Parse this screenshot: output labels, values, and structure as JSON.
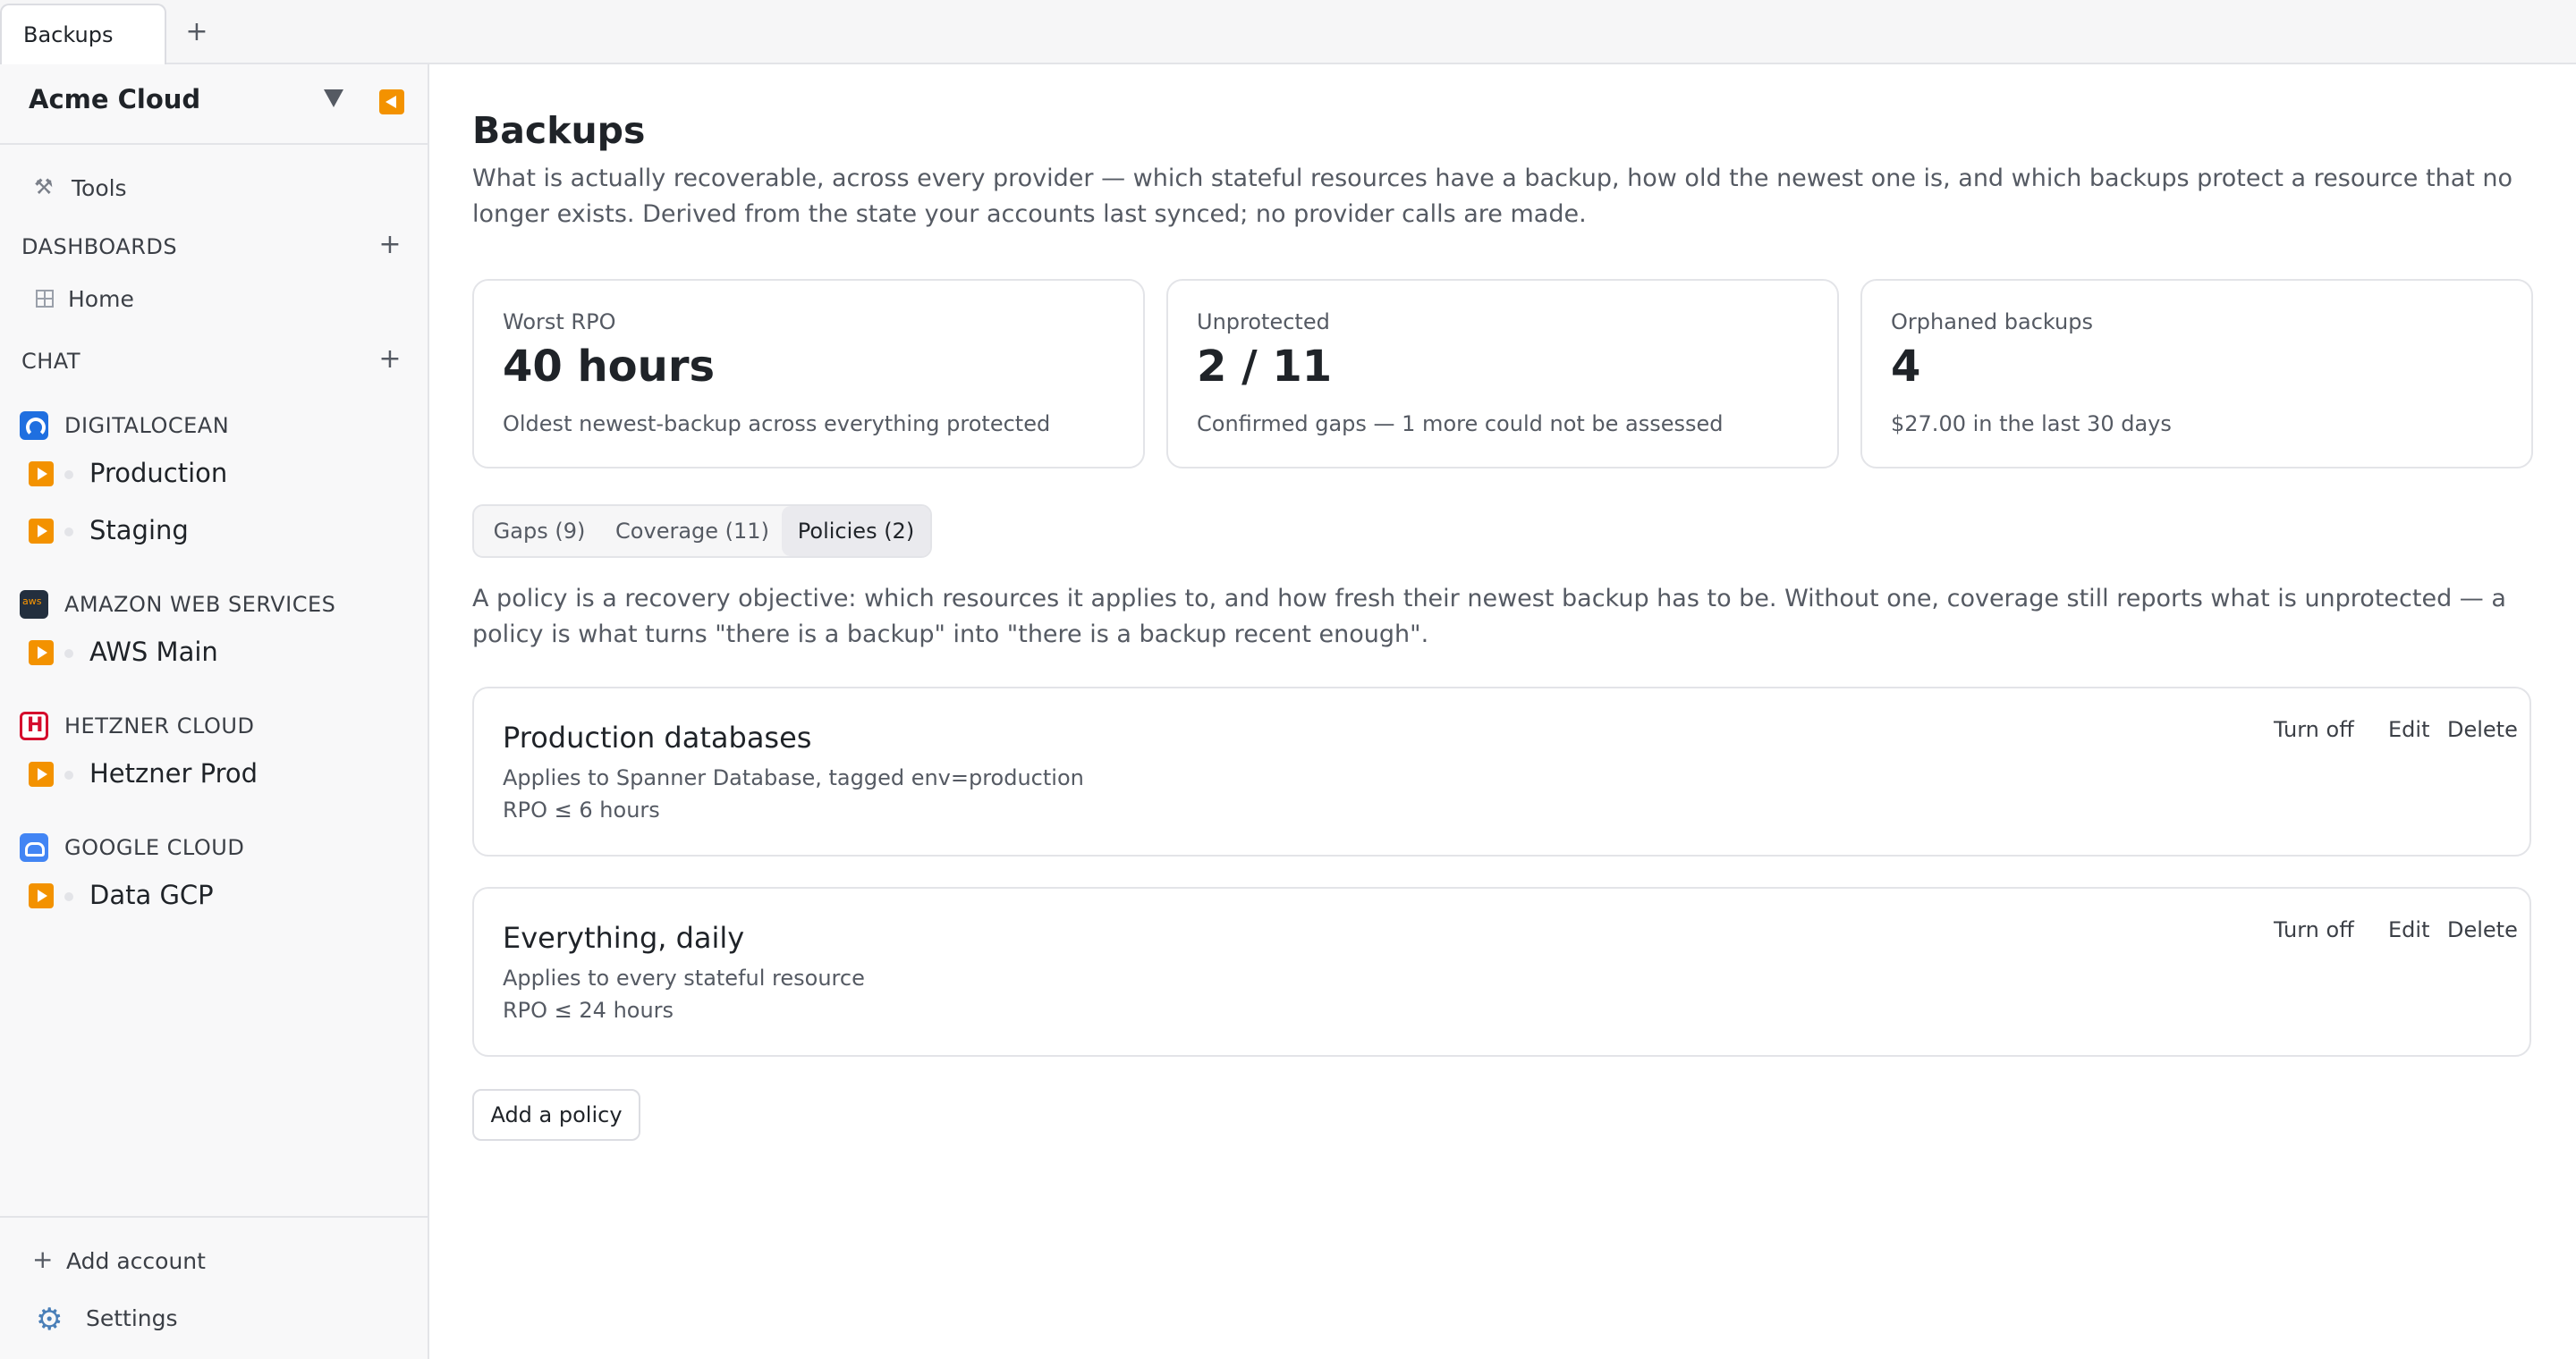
{
  "tabstrip": {
    "tabs": [
      {
        "label": "Backups"
      }
    ],
    "add_tab_label": "+"
  },
  "sidebar": {
    "workspace_name": "Acme Cloud",
    "tools_label": "Tools",
    "dashboards": {
      "label": "DASHBOARDS",
      "add_label": "+",
      "items": [
        {
          "label": "Home"
        }
      ]
    },
    "chat": {
      "label": "CHAT",
      "add_label": "+"
    },
    "providers": [
      {
        "name": "DIGITALOCEAN",
        "icon": "digitalocean-icon",
        "accounts": [
          {
            "label": "Production"
          },
          {
            "label": "Staging"
          }
        ]
      },
      {
        "name": "AMAZON WEB SERVICES",
        "icon": "aws-icon",
        "accounts": [
          {
            "label": "AWS Main"
          }
        ]
      },
      {
        "name": "HETZNER CLOUD",
        "icon": "hetzner-icon",
        "accounts": [
          {
            "label": "Hetzner Prod"
          }
        ]
      },
      {
        "name": "GOOGLE CLOUD",
        "icon": "google-cloud-icon",
        "accounts": [
          {
            "label": "Data GCP"
          }
        ]
      }
    ],
    "add_account_label": "Add account",
    "settings_label": "Settings"
  },
  "main": {
    "title": "Backups",
    "description": "What is actually recoverable, across every provider — which stateful resources have a backup, how old the newest one is, and which backups protect a resource that no longer exists. Derived from the state your accounts last synced; no provider calls are made.",
    "cards": [
      {
        "label": "Worst RPO",
        "value": "40 hours",
        "sub": "Oldest newest-backup across everything protected"
      },
      {
        "label": "Unprotected",
        "value": "2 / 11",
        "sub": "Confirmed gaps — 1 more could not be assessed"
      },
      {
        "label": "Orphaned backups",
        "value": "4",
        "sub": "$27.00 in the last 30 days"
      }
    ],
    "tabs": [
      {
        "label": "Gaps (9)"
      },
      {
        "label": "Coverage (11)"
      },
      {
        "label": "Policies (2)"
      }
    ],
    "active_tab": "Policies (2)",
    "policy_description": "A policy is a recovery objective: which resources it applies to, and how fresh their newest backup has to be. Without one, coverage still reports what is unprotected — a policy is what turns \"there is a backup\" into \"there is a backup recent enough\".",
    "policies": [
      {
        "name": "Production databases",
        "applies": "Applies to Spanner Database, tagged env=production",
        "rpo": "RPO ≤ 6 hours"
      },
      {
        "name": "Everything, daily",
        "applies": "Applies to every stateful resource",
        "rpo": "RPO ≤ 24 hours"
      }
    ],
    "policy_actions": {
      "turn_off": "Turn off",
      "edit": "Edit",
      "delete": "Delete"
    },
    "add_policy_label": "Add a policy"
  },
  "colors": {
    "accent_orange": "#f39200",
    "border": "#e3e4e8",
    "text_primary": "#1f2328",
    "text_muted": "#555a63"
  }
}
